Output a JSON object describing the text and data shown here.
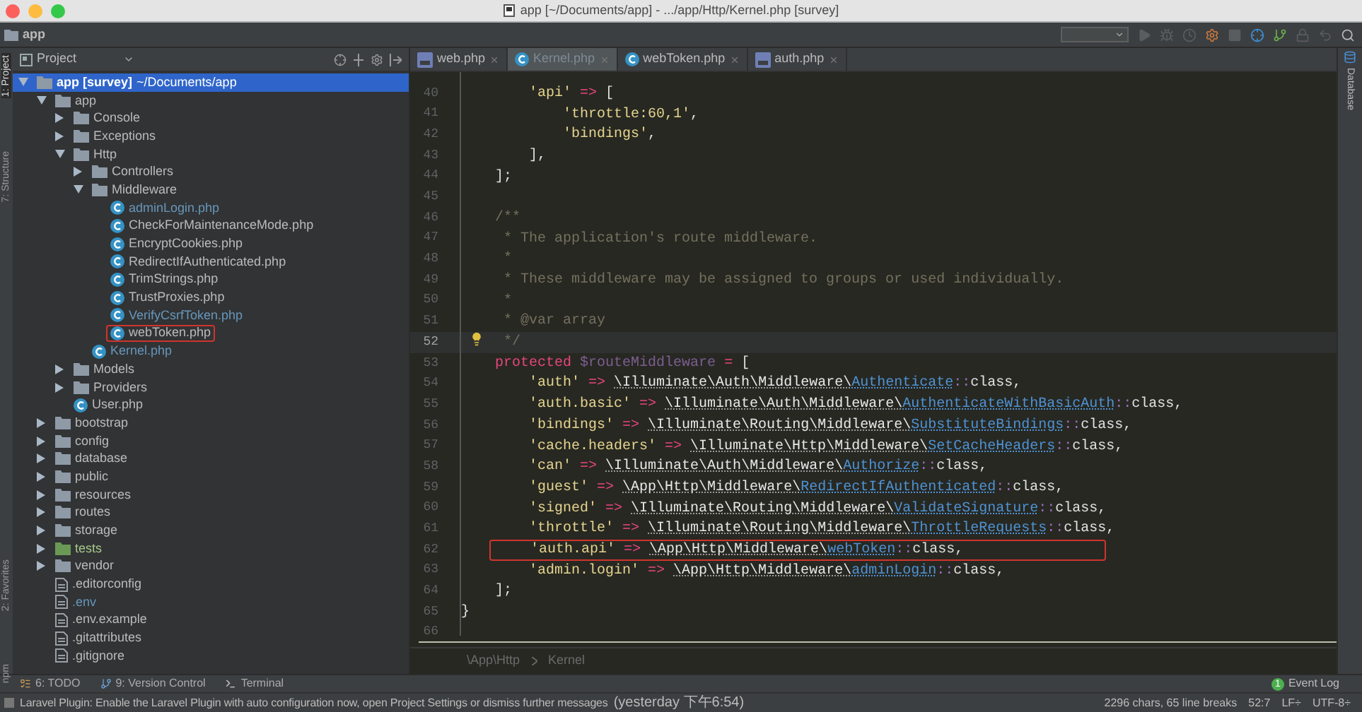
{
  "window": {
    "title": "app [~/Documents/app] - .../app/Http/Kernel.php [survey]"
  },
  "nav_bar": {
    "breadcrumb": "app"
  },
  "left_tool_strip": [
    {
      "label": "1: Project",
      "selected": true
    },
    {
      "label": "7: Structure",
      "selected": false
    },
    {
      "label": "2: Favorites",
      "selected": false
    },
    {
      "label": "npm",
      "selected": false
    }
  ],
  "right_tool_strip": [
    {
      "label": "Database"
    }
  ],
  "project_panel": {
    "title": "Project",
    "tree": [
      {
        "name": "app [survey]",
        "path": "~/Documents/app",
        "kind": "folder",
        "expanded": true,
        "selected": true,
        "modified": false,
        "highlighted": false,
        "children": [
          {
            "name": "app",
            "kind": "folder",
            "expanded": true,
            "selected": false,
            "modified": false,
            "highlighted": false,
            "children": [
              {
                "name": "Console",
                "kind": "folder",
                "expanded": false,
                "selected": false,
                "modified": false,
                "highlighted": false
              },
              {
                "name": "Exceptions",
                "kind": "folder",
                "expanded": false,
                "selected": false,
                "modified": false,
                "highlighted": false
              },
              {
                "name": "Http",
                "kind": "folder",
                "expanded": true,
                "selected": false,
                "modified": false,
                "highlighted": false,
                "children": [
                  {
                    "name": "Controllers",
                    "kind": "folder",
                    "expanded": false,
                    "selected": false,
                    "modified": false,
                    "highlighted": false
                  },
                  {
                    "name": "Middleware",
                    "kind": "folder",
                    "expanded": true,
                    "selected": false,
                    "modified": false,
                    "highlighted": false,
                    "children": [
                      {
                        "name": "adminLogin.php",
                        "kind": "class",
                        "selected": false,
                        "modified": true,
                        "highlighted": false
                      },
                      {
                        "name": "CheckForMaintenanceMode.php",
                        "kind": "class",
                        "selected": false,
                        "modified": false,
                        "highlighted": false
                      },
                      {
                        "name": "EncryptCookies.php",
                        "kind": "class",
                        "selected": false,
                        "modified": false,
                        "highlighted": false
                      },
                      {
                        "name": "RedirectIfAuthenticated.php",
                        "kind": "class",
                        "selected": false,
                        "modified": false,
                        "highlighted": false
                      },
                      {
                        "name": "TrimStrings.php",
                        "kind": "class",
                        "selected": false,
                        "modified": false,
                        "highlighted": false
                      },
                      {
                        "name": "TrustProxies.php",
                        "kind": "class",
                        "selected": false,
                        "modified": false,
                        "highlighted": false
                      },
                      {
                        "name": "VerifyCsrfToken.php",
                        "kind": "class",
                        "selected": false,
                        "modified": true,
                        "highlighted": false
                      },
                      {
                        "name": "webToken.php",
                        "kind": "class",
                        "selected": false,
                        "modified": false,
                        "highlighted": true
                      }
                    ]
                  },
                  {
                    "name": "Kernel.php",
                    "kind": "class",
                    "selected": false,
                    "modified": true,
                    "highlighted": false
                  }
                ]
              },
              {
                "name": "Models",
                "kind": "folder",
                "expanded": false,
                "selected": false,
                "modified": false,
                "highlighted": false
              },
              {
                "name": "Providers",
                "kind": "folder",
                "expanded": false,
                "selected": false,
                "modified": false,
                "highlighted": false
              },
              {
                "name": "User.php",
                "kind": "class",
                "selected": false,
                "modified": false,
                "highlighted": false
              }
            ]
          },
          {
            "name": "bootstrap",
            "kind": "folder",
            "expanded": false,
            "selected": false,
            "modified": false,
            "highlighted": false
          },
          {
            "name": "config",
            "kind": "folder",
            "expanded": false,
            "selected": false,
            "modified": false,
            "highlighted": false
          },
          {
            "name": "database",
            "kind": "folder",
            "expanded": false,
            "selected": false,
            "modified": false,
            "highlighted": false
          },
          {
            "name": "public",
            "kind": "folder",
            "expanded": false,
            "selected": false,
            "modified": false,
            "highlighted": false
          },
          {
            "name": "resources",
            "kind": "folder",
            "expanded": false,
            "selected": false,
            "modified": false,
            "highlighted": false
          },
          {
            "name": "routes",
            "kind": "folder",
            "expanded": false,
            "selected": false,
            "modified": false,
            "highlighted": false
          },
          {
            "name": "storage",
            "kind": "folder",
            "expanded": false,
            "selected": false,
            "modified": false,
            "highlighted": false
          },
          {
            "name": "tests",
            "kind": "test-folder",
            "expanded": false,
            "selected": false,
            "modified": false,
            "highlighted": false
          },
          {
            "name": "vendor",
            "kind": "folder",
            "expanded": false,
            "selected": false,
            "modified": false,
            "highlighted": false
          },
          {
            "name": ".editorconfig",
            "kind": "file",
            "selected": false,
            "modified": false,
            "highlighted": false
          },
          {
            "name": ".env",
            "kind": "file",
            "selected": false,
            "modified": true,
            "highlighted": false
          },
          {
            "name": ".env.example",
            "kind": "file",
            "selected": false,
            "modified": false,
            "highlighted": false
          },
          {
            "name": ".gitattributes",
            "kind": "file",
            "selected": false,
            "modified": false,
            "highlighted": false
          },
          {
            "name": ".gitignore",
            "kind": "file",
            "selected": false,
            "modified": false,
            "highlighted": false
          }
        ]
      }
    ]
  },
  "editor": {
    "tabs": [
      {
        "label": "web.php",
        "kind": "php",
        "selected": false
      },
      {
        "label": "Kernel.php",
        "kind": "class",
        "selected": true
      },
      {
        "label": "webToken.php",
        "kind": "class",
        "selected": false
      },
      {
        "label": "auth.php",
        "kind": "php",
        "selected": false
      }
    ],
    "lines": [
      {
        "number": "40",
        "current": false,
        "highlighted": false,
        "tokens": [
          {
            "kind": "str",
            "text": "        'api' "
          },
          {
            "kind": "op",
            "text": "=> "
          },
          {
            "kind": "plain",
            "text": "["
          }
        ]
      },
      {
        "number": "41",
        "current": false,
        "highlighted": false,
        "tokens": [
          {
            "kind": "str",
            "text": "            'throttle:60,1'"
          },
          {
            "kind": "plain",
            "text": ","
          }
        ]
      },
      {
        "number": "42",
        "current": false,
        "highlighted": false,
        "tokens": [
          {
            "kind": "str",
            "text": "            'bindings'"
          },
          {
            "kind": "plain",
            "text": ","
          }
        ]
      },
      {
        "number": "43",
        "current": false,
        "highlighted": false,
        "tokens": [
          {
            "kind": "plain",
            "text": "        ],"
          }
        ]
      },
      {
        "number": "44",
        "current": false,
        "highlighted": false,
        "tokens": [
          {
            "kind": "plain",
            "text": "    ];"
          }
        ]
      },
      {
        "number": "45",
        "current": false,
        "highlighted": false
      },
      {
        "number": "46",
        "current": false,
        "highlighted": false,
        "tokens": [
          {
            "kind": "comment",
            "text": "    /**"
          }
        ]
      },
      {
        "number": "47",
        "current": false,
        "highlighted": false,
        "tokens": [
          {
            "kind": "comment",
            "text": "     * The application's route middleware."
          }
        ]
      },
      {
        "number": "48",
        "current": false,
        "highlighted": false,
        "tokens": [
          {
            "kind": "comment",
            "text": "     *"
          }
        ]
      },
      {
        "number": "49",
        "current": false,
        "highlighted": false,
        "tokens": [
          {
            "kind": "comment",
            "text": "     * These middleware may be assigned to groups or used individually."
          }
        ]
      },
      {
        "number": "50",
        "current": false,
        "highlighted": false,
        "tokens": [
          {
            "kind": "comment",
            "text": "     *"
          }
        ]
      },
      {
        "number": "51",
        "current": false,
        "highlighted": false,
        "tokens": [
          {
            "kind": "comment",
            "text": "     * @var array"
          }
        ]
      },
      {
        "number": "52",
        "current": true,
        "highlighted": false,
        "tokens": [
          {
            "kind": "comment",
            "text": "     */"
          }
        ]
      },
      {
        "number": "53",
        "current": false,
        "highlighted": false,
        "tokens": [
          {
            "kind": "kw",
            "text": "    protected "
          },
          {
            "kind": "var",
            "text": "$routeMiddleware "
          },
          {
            "kind": "op",
            "text": "= "
          },
          {
            "kind": "plain",
            "text": "["
          }
        ]
      },
      {
        "number": "54",
        "current": false,
        "highlighted": false,
        "tokens": [
          {
            "kind": "str",
            "text": "        'auth' "
          },
          {
            "kind": "op",
            "text": "=> "
          },
          {
            "kind": "ns",
            "text": "\\Illuminate\\Auth\\Middleware\\"
          },
          {
            "kind": "cls",
            "text": "Authenticate"
          },
          {
            "kind": "sym",
            "text": "::"
          },
          {
            "kind": "plain",
            "text": "class,"
          }
        ]
      },
      {
        "number": "55",
        "current": false,
        "highlighted": false,
        "tokens": [
          {
            "kind": "str",
            "text": "        'auth.basic' "
          },
          {
            "kind": "op",
            "text": "=> "
          },
          {
            "kind": "ns",
            "text": "\\Illuminate\\Auth\\Middleware\\"
          },
          {
            "kind": "cls",
            "text": "AuthenticateWithBasicAuth"
          },
          {
            "kind": "sym",
            "text": "::"
          },
          {
            "kind": "plain",
            "text": "class,"
          }
        ]
      },
      {
        "number": "56",
        "current": false,
        "highlighted": false,
        "tokens": [
          {
            "kind": "str",
            "text": "        'bindings' "
          },
          {
            "kind": "op",
            "text": "=> "
          },
          {
            "kind": "ns",
            "text": "\\Illuminate\\Routing\\Middleware\\"
          },
          {
            "kind": "cls",
            "text": "SubstituteBindings"
          },
          {
            "kind": "sym",
            "text": "::"
          },
          {
            "kind": "plain",
            "text": "class,"
          }
        ]
      },
      {
        "number": "57",
        "current": false,
        "highlighted": false,
        "tokens": [
          {
            "kind": "str",
            "text": "        'cache.headers' "
          },
          {
            "kind": "op",
            "text": "=> "
          },
          {
            "kind": "ns",
            "text": "\\Illuminate\\Http\\Middleware\\"
          },
          {
            "kind": "cls",
            "text": "SetCacheHeaders"
          },
          {
            "kind": "sym",
            "text": "::"
          },
          {
            "kind": "plain",
            "text": "class,"
          }
        ]
      },
      {
        "number": "58",
        "current": false,
        "highlighted": false,
        "tokens": [
          {
            "kind": "str",
            "text": "        'can' "
          },
          {
            "kind": "op",
            "text": "=> "
          },
          {
            "kind": "ns",
            "text": "\\Illuminate\\Auth\\Middleware\\"
          },
          {
            "kind": "cls",
            "text": "Authorize"
          },
          {
            "kind": "sym",
            "text": "::"
          },
          {
            "kind": "plain",
            "text": "class,"
          }
        ]
      },
      {
        "number": "59",
        "current": false,
        "highlighted": false,
        "tokens": [
          {
            "kind": "str",
            "text": "        'guest' "
          },
          {
            "kind": "op",
            "text": "=> "
          },
          {
            "kind": "ns",
            "text": "\\App\\Http\\Middleware\\"
          },
          {
            "kind": "cls",
            "text": "RedirectIfAuthenticated"
          },
          {
            "kind": "sym",
            "text": "::"
          },
          {
            "kind": "plain",
            "text": "class,"
          }
        ]
      },
      {
        "number": "60",
        "current": false,
        "highlighted": false,
        "tokens": [
          {
            "kind": "str",
            "text": "        'signed' "
          },
          {
            "kind": "op",
            "text": "=> "
          },
          {
            "kind": "ns",
            "text": "\\Illuminate\\Routing\\Middleware\\"
          },
          {
            "kind": "cls",
            "text": "ValidateSignature"
          },
          {
            "kind": "sym",
            "text": "::"
          },
          {
            "kind": "plain",
            "text": "class,"
          }
        ]
      },
      {
        "number": "61",
        "current": false,
        "highlighted": false,
        "tokens": [
          {
            "kind": "str",
            "text": "        'throttle' "
          },
          {
            "kind": "op",
            "text": "=> "
          },
          {
            "kind": "ns",
            "text": "\\Illuminate\\Routing\\Middleware\\"
          },
          {
            "kind": "cls",
            "text": "ThrottleRequests"
          },
          {
            "kind": "sym",
            "text": "::"
          },
          {
            "kind": "plain",
            "text": "class,"
          }
        ]
      },
      {
        "number": "62",
        "current": false,
        "highlighted": true,
        "tokens": [
          {
            "kind": "str",
            "text": "'auth.api' "
          },
          {
            "kind": "op",
            "text": "=> "
          },
          {
            "kind": "ns",
            "text": "\\App\\Http\\Middleware\\"
          },
          {
            "kind": "cls",
            "text": "webToken"
          },
          {
            "kind": "sym",
            "text": "::"
          },
          {
            "kind": "plain",
            "text": "class,"
          }
        ]
      },
      {
        "number": "63",
        "current": false,
        "highlighted": false,
        "tokens": [
          {
            "kind": "str",
            "text": "        'admin.login' "
          },
          {
            "kind": "op",
            "text": "=> "
          },
          {
            "kind": "ns",
            "text": "\\App\\Http\\Middleware\\"
          },
          {
            "kind": "cls",
            "text": "adminLogin"
          },
          {
            "kind": "sym",
            "text": "::"
          },
          {
            "kind": "plain",
            "text": "class,"
          }
        ]
      },
      {
        "number": "64",
        "current": false,
        "highlighted": false,
        "tokens": [
          {
            "kind": "plain",
            "text": "    ];"
          }
        ]
      },
      {
        "number": "65",
        "current": false,
        "highlighted": false,
        "tokens": [
          {
            "kind": "plain",
            "text": "}"
          }
        ]
      },
      {
        "number": "66",
        "current": false,
        "highlighted": false
      }
    ],
    "breadcrumb": [
      "\\App\\Http",
      "Kernel"
    ]
  },
  "tool_windows": [
    {
      "label": "6: TODO",
      "kind": "todo"
    },
    {
      "label": "9: Version Control",
      "kind": "vcs"
    },
    {
      "label": "Terminal",
      "kind": "terminal"
    }
  ],
  "event_log": {
    "label": "Event Log",
    "count": "1"
  },
  "status_bar": {
    "message": "Laravel Plugin: Enable the Laravel Plugin with auto configuration now, open Project Settings or dismiss further messages",
    "time": "(yesterday 下午6:54)",
    "items": [
      "2296 chars, 65 line breaks",
      "52:7",
      "LF÷",
      "UTF-8÷"
    ]
  }
}
